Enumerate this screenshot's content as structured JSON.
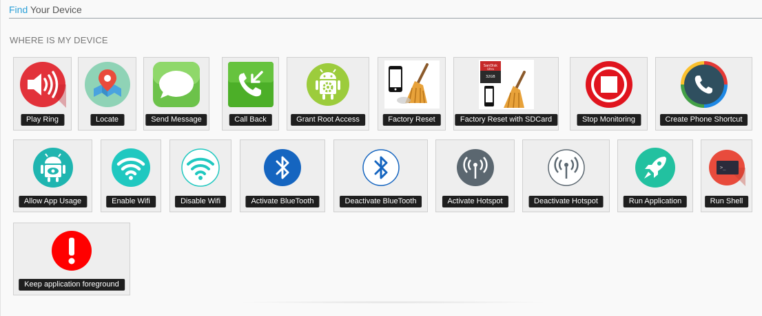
{
  "header": {
    "find": "Find",
    "rest": " Your Device"
  },
  "section": {
    "title": "WHERE IS MY DEVICE"
  },
  "tiles": [
    {
      "label": "Play Ring",
      "icon": "speaker-icon"
    },
    {
      "label": "Locate",
      "icon": "map-pin-icon"
    },
    {
      "label": "Send Message",
      "icon": "message-bubble-icon"
    },
    {
      "label": "Call Back",
      "icon": "call-back-icon"
    },
    {
      "label": "Grant Root Access",
      "icon": "android-gear-icon"
    },
    {
      "label": "Factory Reset",
      "icon": "phone-broom-icon"
    },
    {
      "label": "Factory Reset with SDCard",
      "icon": "sdcard-broom-icon"
    },
    {
      "label": "Stop Monitoring",
      "icon": "stop-icon"
    },
    {
      "label": "Create Phone Shortcut",
      "icon": "phone-shortcut-icon"
    },
    {
      "label": "Allow App Usage",
      "icon": "android-eye-icon"
    },
    {
      "label": "Enable Wifi",
      "icon": "wifi-icon"
    },
    {
      "label": "Disable Wifi",
      "icon": "wifi-outline-icon"
    },
    {
      "label": "Activate BlueTooth",
      "icon": "bluetooth-icon"
    },
    {
      "label": "Deactivate BlueTooth",
      "icon": "bluetooth-outline-icon"
    },
    {
      "label": "Activate Hotspot",
      "icon": "hotspot-icon"
    },
    {
      "label": "Deactivate Hotspot",
      "icon": "hotspot-outline-icon"
    },
    {
      "label": "Run Application",
      "icon": "rocket-icon"
    },
    {
      "label": "Run Shell",
      "icon": "terminal-icon"
    },
    {
      "label": "Keep application foreground",
      "icon": "alert-icon"
    }
  ],
  "terminal_prompt": ">_",
  "sdcard_text": {
    "brand": "SanDisk",
    "model": "Ultra",
    "size": "32GB"
  },
  "colors": {
    "find_blue": "#2a9fd8",
    "play_ring": "#e2323a",
    "locate": "#8fd3b6",
    "message": "#6cc24a",
    "call_back": "#4caf28",
    "android": "#9ccc3c",
    "stop": "#e0141e",
    "allow_app": "#1fb5b0",
    "wifi": "#20c8c0",
    "bluetooth": "#1565c0",
    "hotspot": "#5b6770",
    "rocket": "#22c1a0",
    "shell": "#e84b3c",
    "alert": "#ff0000"
  }
}
